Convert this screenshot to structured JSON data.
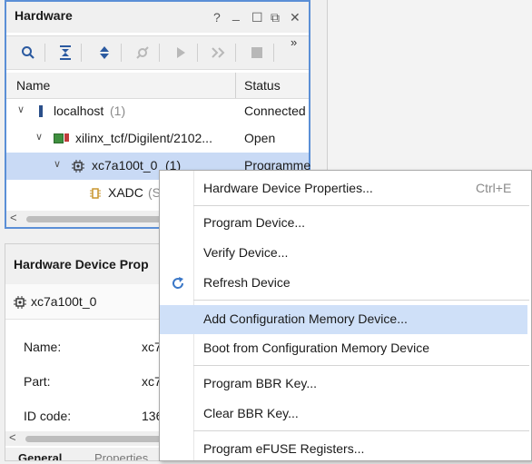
{
  "hardware_panel": {
    "title": "Hardware",
    "header_icons": {
      "help": "?",
      "minimize": "_",
      "maximize": "☐",
      "restore": "⧉",
      "close": "✕"
    },
    "toolbar": {
      "overflow": "»"
    },
    "columns": {
      "name": "Name",
      "status": "Status"
    },
    "tree": [
      {
        "label": "localhost",
        "suffix": "(1)",
        "status": "Connected"
      },
      {
        "label": "xilinx_tcf/Digilent/2102...",
        "status": "Open"
      },
      {
        "label": "xc7a100t_0",
        "suffix": "(1)",
        "status": "Programme"
      },
      {
        "label": "XADC",
        "suffix": "(S"
      }
    ]
  },
  "device_properties": {
    "title": "Hardware Device Prop",
    "device_name": "xc7a100t_0",
    "properties": [
      {
        "label": "Name:",
        "value": "xc7"
      },
      {
        "label": "Part:",
        "value": "xc7"
      },
      {
        "label": "ID code:",
        "value": "136"
      }
    ],
    "tabs": {
      "general": "General",
      "properties": "Properties"
    }
  },
  "context_menu": {
    "items": [
      {
        "label": "Hardware Device Properties...",
        "shortcut": "Ctrl+E"
      },
      {
        "label": "Program Device..."
      },
      {
        "label": "Verify Device..."
      },
      {
        "label": "Refresh Device"
      },
      {
        "label": "Add Configuration Memory Device..."
      },
      {
        "label": "Boot from Configuration Memory Device"
      },
      {
        "label": "Program BBR Key..."
      },
      {
        "label": "Clear BBR Key..."
      },
      {
        "label": "Program eFUSE Registers..."
      }
    ]
  },
  "colors": {
    "accent_border": "#5b8fd6",
    "selection": "#c9daf5",
    "menu_highlight": "#cfe0f8",
    "refresh_icon": "#3a77c7"
  }
}
